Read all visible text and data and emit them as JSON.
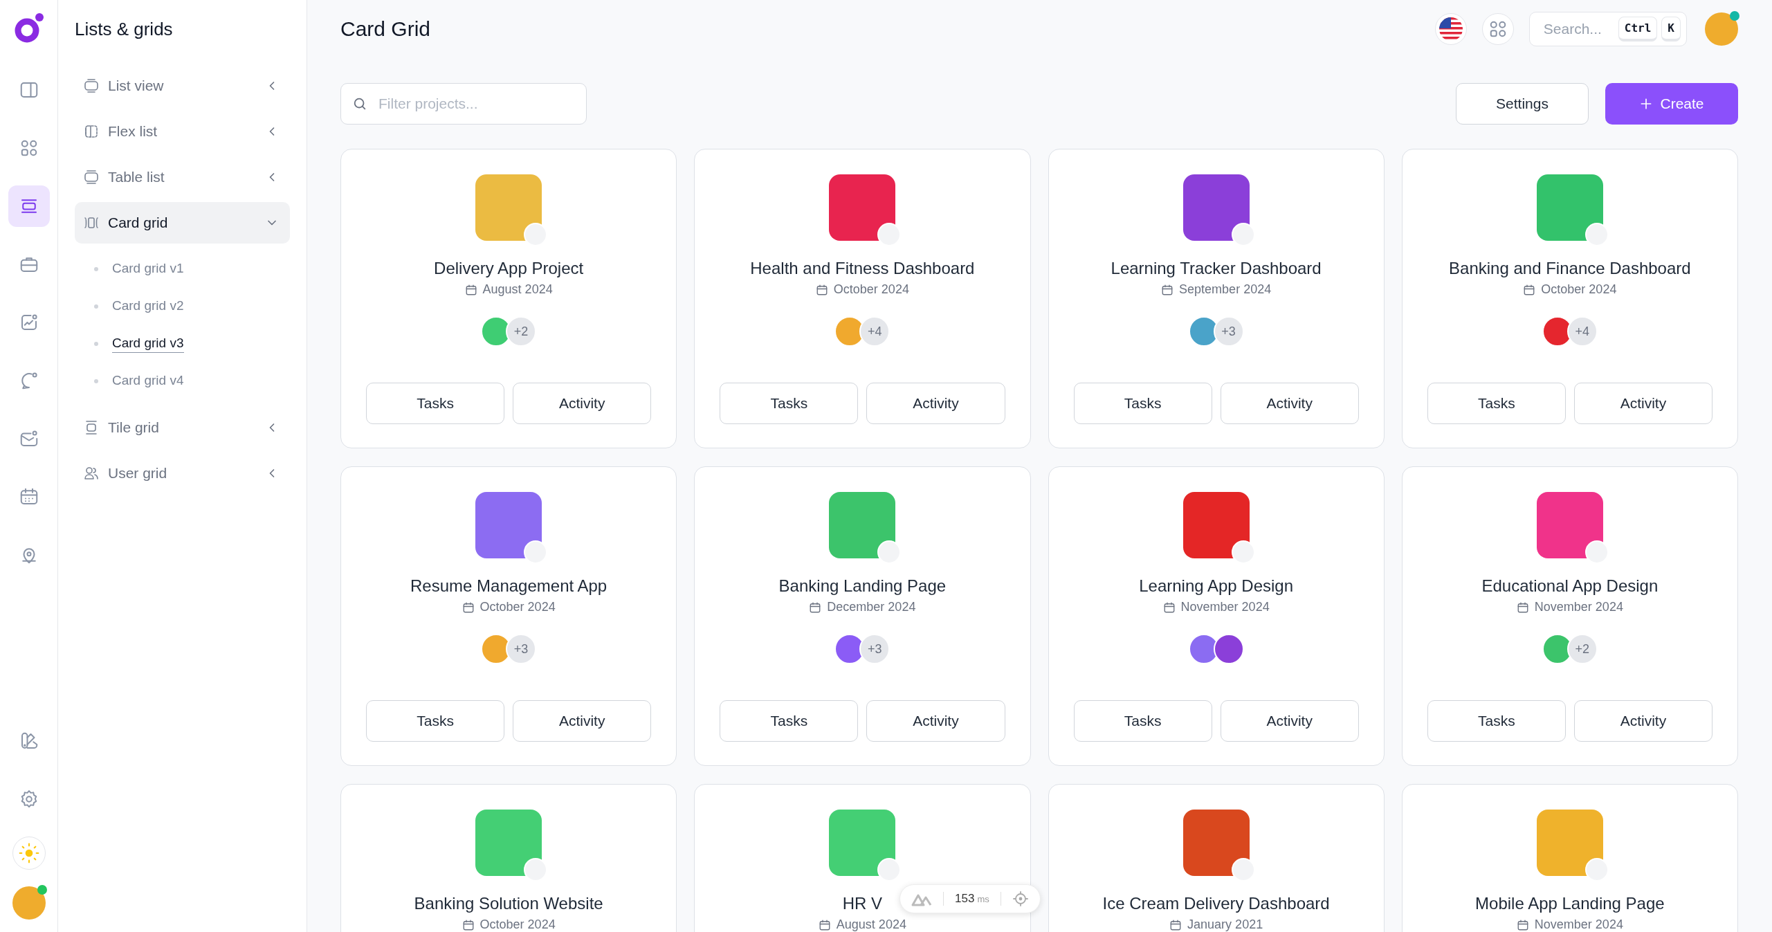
{
  "rail": {
    "items": [
      {
        "kind": "panel",
        "selected": false
      },
      {
        "kind": "grid",
        "selected": false
      },
      {
        "kind": "list",
        "selected": true
      },
      {
        "kind": "briefcase",
        "selected": false
      },
      {
        "kind": "chart",
        "selected": false
      },
      {
        "kind": "chat",
        "selected": false
      },
      {
        "kind": "mail",
        "selected": false
      },
      {
        "kind": "calendar",
        "selected": false
      },
      {
        "kind": "location",
        "selected": false
      }
    ],
    "bottom": [
      {
        "kind": "palette"
      },
      {
        "kind": "settings"
      },
      {
        "kind": "theme"
      },
      {
        "kind": "avatar"
      }
    ]
  },
  "sidebar": {
    "title": "Lists & grids",
    "items": [
      {
        "kind": "list",
        "label": "List view",
        "expanded": false
      },
      {
        "kind": "flex",
        "label": "Flex list",
        "expanded": false
      },
      {
        "kind": "table",
        "label": "Table list",
        "expanded": false
      },
      {
        "kind": "card",
        "label": "Card grid",
        "expanded": true,
        "children": [
          {
            "label": "Card grid v1",
            "selected": false
          },
          {
            "label": "Card grid v2",
            "selected": false
          },
          {
            "label": "Card grid v3",
            "selected": true
          },
          {
            "label": "Card grid v4",
            "selected": false
          }
        ]
      },
      {
        "kind": "tile",
        "label": "Tile grid",
        "expanded": false
      },
      {
        "kind": "user",
        "label": "User grid",
        "expanded": false
      }
    ]
  },
  "header": {
    "title": "Card Grid",
    "search": {
      "placeholder": "Search...",
      "keys": [
        "Ctrl",
        "K"
      ]
    }
  },
  "toolbar": {
    "filter": {
      "placeholder": "Filter projects..."
    },
    "buttons": [
      {
        "kind": "secondary",
        "label": "Settings"
      },
      {
        "kind": "primary",
        "label": "Create"
      }
    ]
  },
  "cards": [
    {
      "title": "Delivery App Project",
      "date": "August 2024",
      "color": "#ebbb42",
      "members": [
        {
          "color": "#3fcd73"
        }
      ],
      "extra": "+2",
      "buttons": [
        "Tasks",
        "Activity"
      ]
    },
    {
      "title": "Health and Fitness Dashboard",
      "date": "October 2024",
      "color": "#e8244f",
      "members": [
        {
          "color": "#f0a92e"
        }
      ],
      "extra": "+4",
      "buttons": [
        "Tasks",
        "Activity"
      ]
    },
    {
      "title": "Learning Tracker Dashboard",
      "date": "September 2024",
      "color": "#8b3fd9",
      "members": [
        {
          "color": "#4aa3c9"
        }
      ],
      "extra": "+3",
      "buttons": [
        "Tasks",
        "Activity"
      ]
    },
    {
      "title": "Banking and Finance Dashboard",
      "date": "October 2024",
      "color": "#33c26b",
      "members": [
        {
          "color": "#e5262e"
        }
      ],
      "extra": "+4",
      "buttons": [
        "Tasks",
        "Activity"
      ]
    },
    {
      "title": "Resume Management App",
      "date": "October 2024",
      "color": "#8c6cf2",
      "members": [
        {
          "color": "#f0a92e"
        }
      ],
      "extra": "+3",
      "buttons": [
        "Tasks",
        "Activity"
      ]
    },
    {
      "title": "Banking Landing Page",
      "date": "December 2024",
      "color": "#3cc46b",
      "members": [
        {
          "color": "#8b5cf6"
        }
      ],
      "extra": "+3",
      "buttons": [
        "Tasks",
        "Activity"
      ]
    },
    {
      "title": "Learning App Design",
      "date": "November 2024",
      "color": "#e42626",
      "members": [
        {
          "color": "#8b6cf2"
        },
        {
          "color": "#8b3fd9"
        }
      ],
      "buttons": [
        "Tasks",
        "Activity"
      ]
    },
    {
      "title": "Educational App Design",
      "date": "November 2024",
      "color": "#f0338a",
      "members": [
        {
          "color": "#3cc46b"
        }
      ],
      "extra": "+2",
      "buttons": [
        "Tasks",
        "Activity"
      ]
    },
    {
      "title": "Banking Solution Website",
      "date": "October 2024",
      "color": "#44cf74"
    },
    {
      "title": "HR V",
      "date": "August 2024",
      "color": "#44cf74"
    },
    {
      "title": "Ice Cream Delivery Dashboard",
      "date": "January 2021",
      "color": "#d9481e"
    },
    {
      "title": "Mobile App Landing Page",
      "date": "November 2024",
      "color": "#efb22c"
    }
  ],
  "devtools": {
    "time": "153",
    "unit": "ms"
  }
}
